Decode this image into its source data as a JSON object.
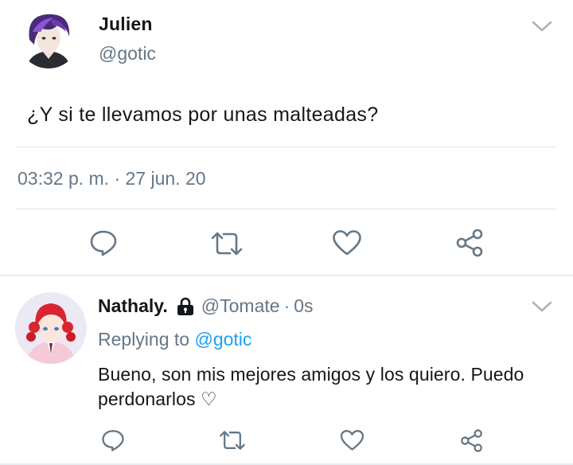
{
  "main_tweet": {
    "name": "Julien",
    "handle": "@gotic",
    "text": "¿Y si te llevamos por unas malteadas?",
    "timestamp": "03:32 p. m. · 27 jun. 20",
    "avatar": "avatar-purple-hair-icon",
    "actions": [
      "reply-icon",
      "retweet-icon",
      "like-icon",
      "share-icon"
    ]
  },
  "reply": {
    "name": "Nathaly.",
    "lock": "lock-icon",
    "handle": "@Tomate",
    "separator": "·",
    "time": "0s",
    "replying_prefix": "Replying to",
    "replying_user": "@gotic",
    "text": "Bueno, son mis mejores amigos y los quiero. Puedo perdonarlos ♡",
    "avatar": "avatar-red-hair-icon",
    "actions": [
      "reply-icon",
      "retweet-icon",
      "like-icon",
      "share-icon"
    ]
  },
  "colors": {
    "primary_text": "#14171a",
    "secondary_text": "#657786",
    "link": "#1da1f2",
    "divider": "#e1e8ed",
    "icon": "#657786"
  }
}
